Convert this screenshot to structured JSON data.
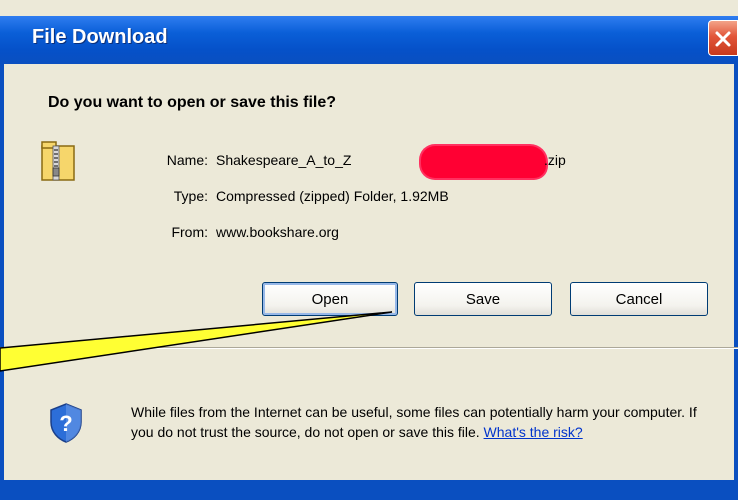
{
  "dialog": {
    "title": "File Download",
    "question": "Do you want to open or save this file?",
    "file": {
      "name_label": "Name:",
      "name_value": "Shakespeare_A_to_Z",
      "name_ext": ".zip",
      "type_label": "Type:",
      "type_value": "Compressed (zipped) Folder, 1.92MB",
      "from_label": "From:",
      "from_value": "www.bookshare.org"
    },
    "buttons": {
      "open": "Open",
      "save": "Save",
      "cancel": "Cancel"
    },
    "warning": {
      "text": "While files from the Internet can be useful, some files can potentially harm your computer. If you do not trust the source, do not open or save this file.",
      "link": "What's the risk?"
    }
  },
  "colors": {
    "titlebar": "#0a5fd8",
    "dialog_bg": "#ece9d8",
    "redaction": "#ff0033",
    "callout": "#ffff33"
  },
  "icons": [
    "close-icon",
    "zip-folder-icon",
    "shield-question-icon"
  ]
}
